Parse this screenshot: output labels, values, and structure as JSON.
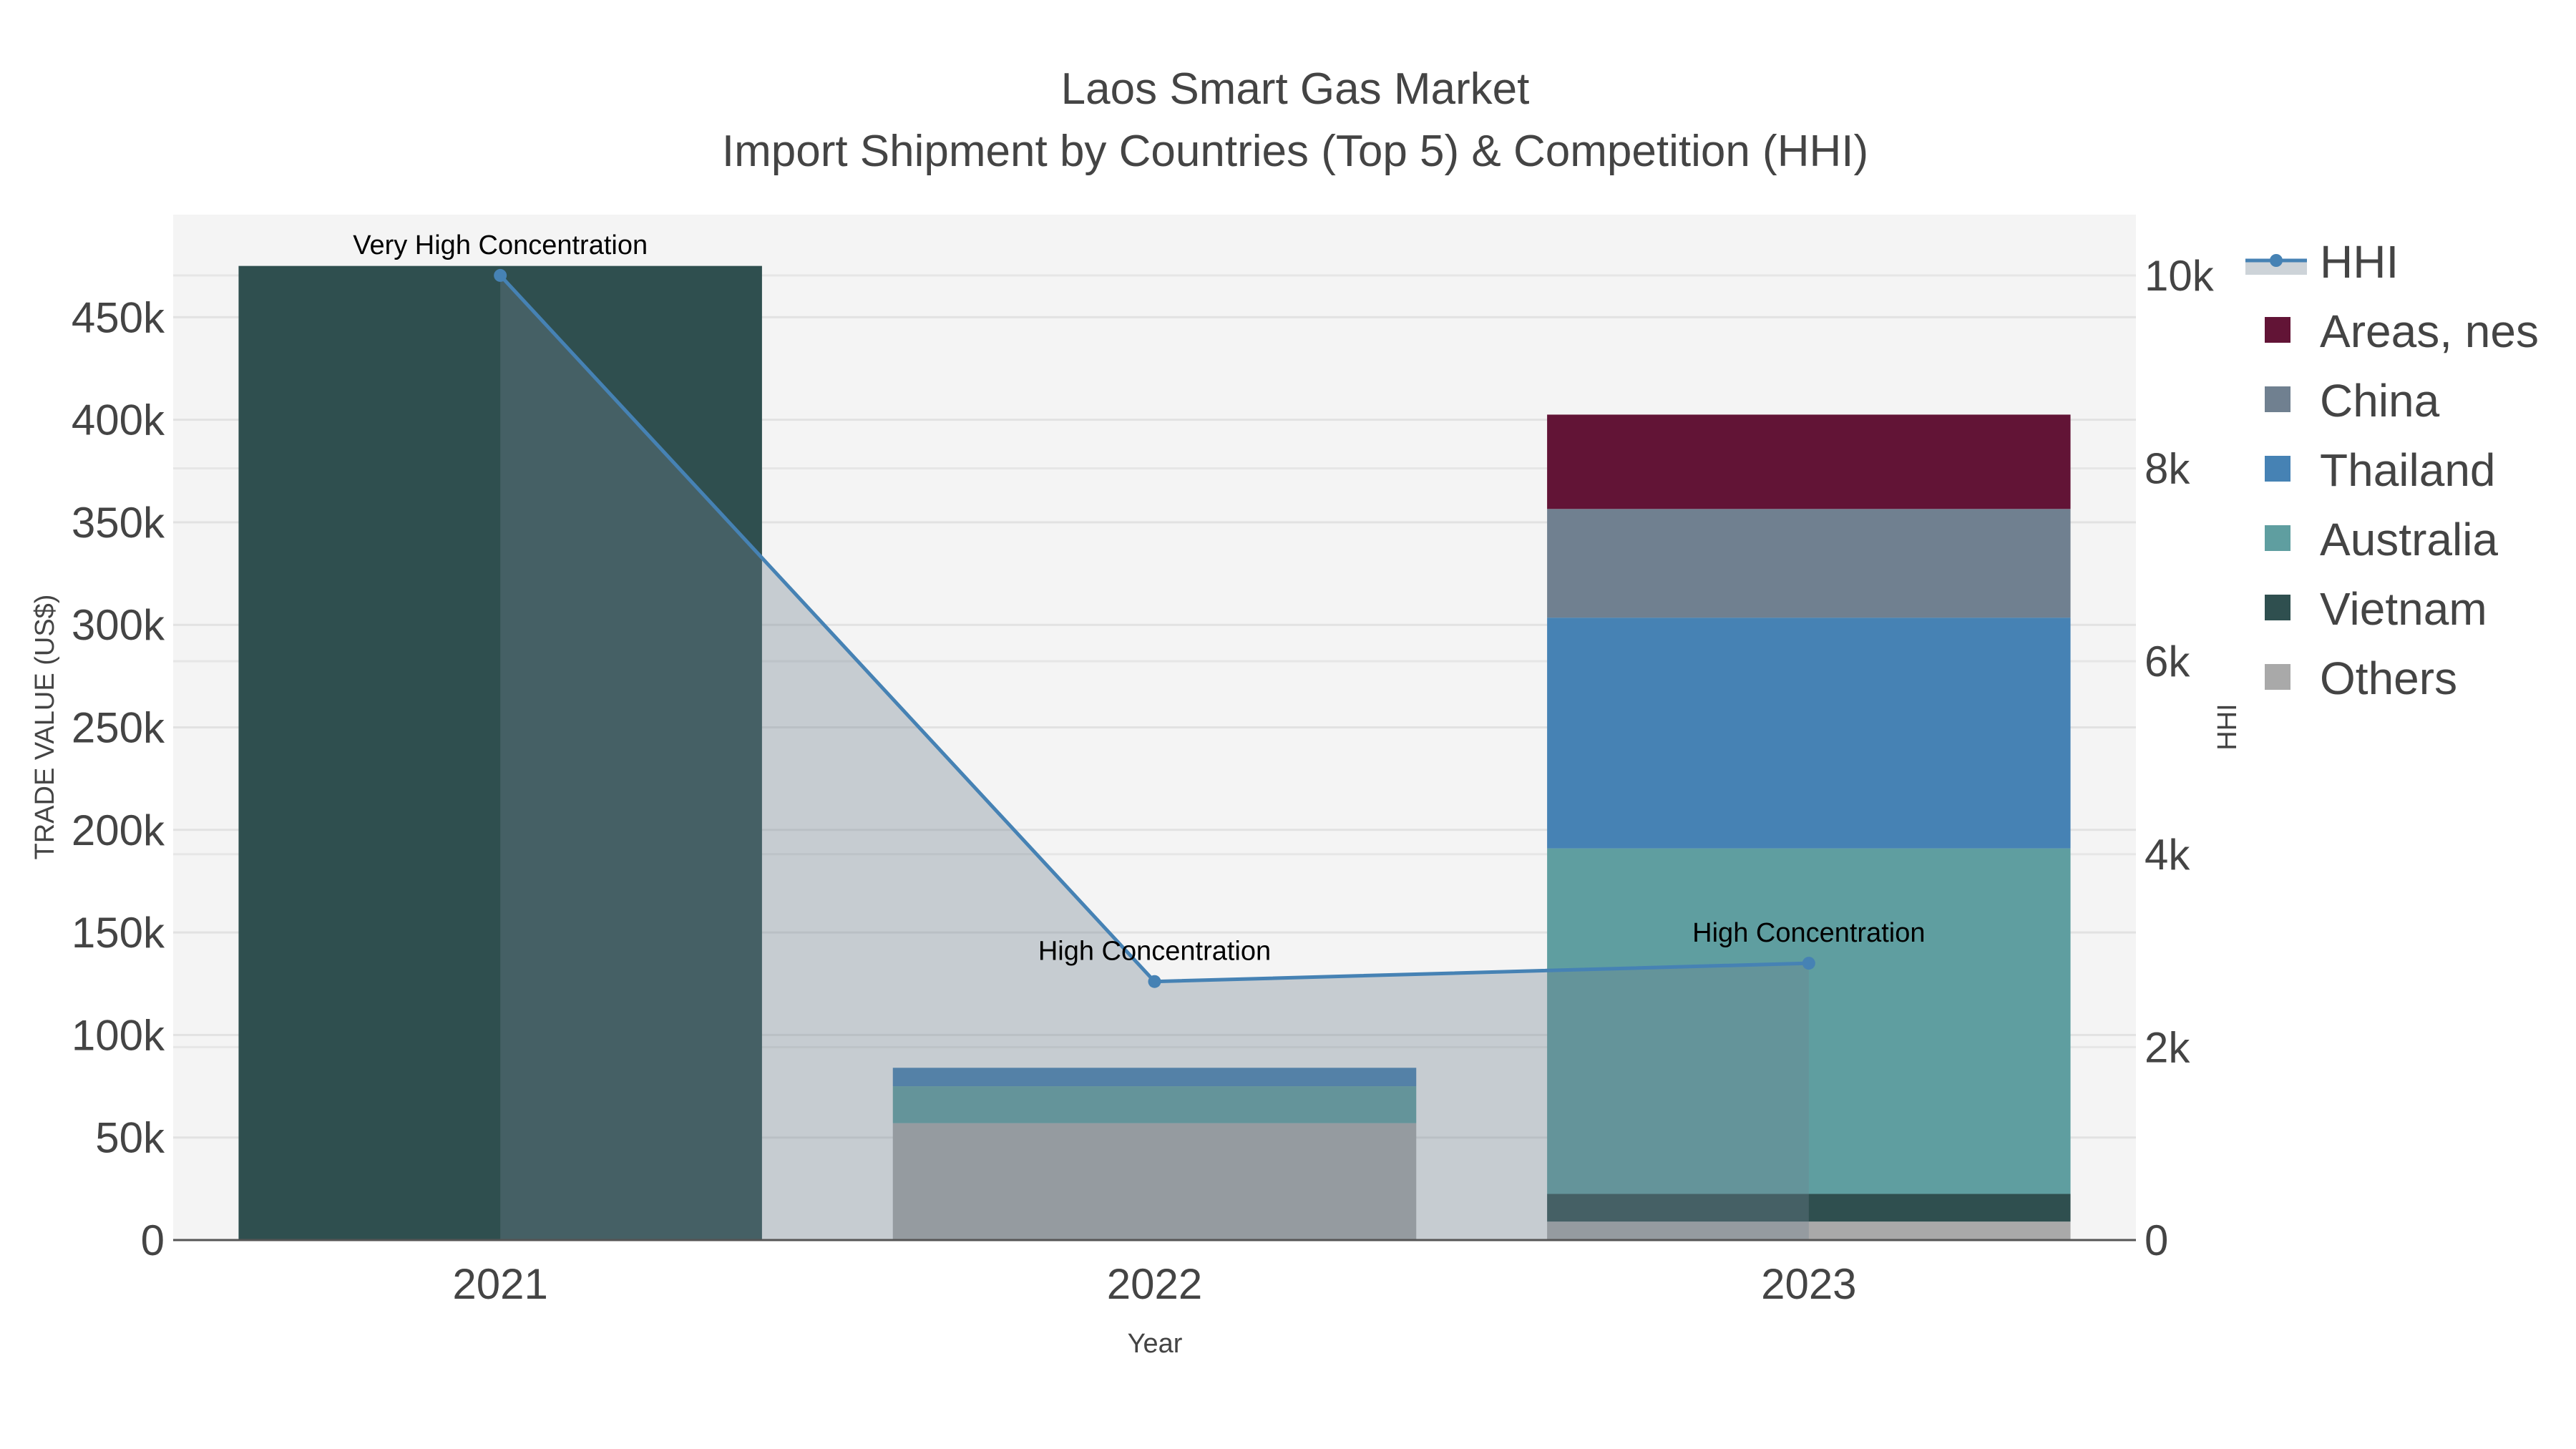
{
  "chart_data": {
    "type": "bar",
    "title": "Laos Smart Gas Market",
    "subtitle": "Import Shipment by Countries (Top 5) & Competition (HHI)",
    "xlabel": "Year",
    "ylabel": "TRADE VALUE (US$)",
    "y2label": "HHI",
    "categories": [
      "2021",
      "2022",
      "2023"
    ],
    "ylim": [
      0,
      500000
    ],
    "y2lim": [
      0,
      10630
    ],
    "yticks": [
      0,
      50000,
      100000,
      150000,
      200000,
      250000,
      300000,
      350000,
      400000,
      450000
    ],
    "yticklabels": [
      "0",
      "50k",
      "100k",
      "150k",
      "200k",
      "250k",
      "300k",
      "350k",
      "400k",
      "450k"
    ],
    "y2ticks": [
      0,
      2000,
      4000,
      6000,
      8000,
      10000
    ],
    "y2ticklabels": [
      "0",
      "2k",
      "4k",
      "6k",
      "8k",
      "10k"
    ],
    "stacked": true,
    "series": [
      {
        "name": "Others",
        "color": "#a9a9a9",
        "values": [
          0,
          57000,
          9000
        ]
      },
      {
        "name": "Vietnam",
        "color": "#2f4f4f",
        "values": [
          475000,
          0,
          13500
        ]
      },
      {
        "name": "Australia",
        "color": "#5f9ea0",
        "values": [
          0,
          18000,
          168500
        ]
      },
      {
        "name": "Thailand",
        "color": "#4682b4",
        "values": [
          0,
          9000,
          112500
        ]
      },
      {
        "name": "China",
        "color": "#708090",
        "values": [
          0,
          0,
          53000
        ]
      },
      {
        "name": "Areas, nes",
        "color": "#621436",
        "values": [
          0,
          0,
          46000
        ]
      }
    ],
    "line": {
      "name": "HHI",
      "color": "#4682b4",
      "fill": "rgba(112,128,144,0.35)",
      "values": [
        10000,
        2680,
        2870
      ]
    },
    "annotations": [
      "Very High Concentration",
      "High Concentration",
      "High Concentration"
    ],
    "legend": {
      "placement": "right",
      "order": [
        "HHI",
        "Areas, nes",
        "China",
        "Thailand",
        "Australia",
        "Vietnam",
        "Others"
      ]
    },
    "grid": true
  }
}
